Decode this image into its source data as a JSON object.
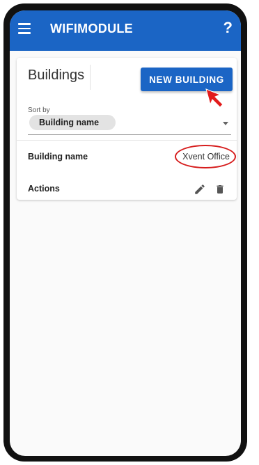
{
  "app": {
    "title": "WIFIMODULE",
    "help_label": "?",
    "accent_color": "#1b65c5"
  },
  "card": {
    "title": "Buildings",
    "new_building_label": "NEW BUILDING",
    "sort": {
      "label": "Sort by",
      "selected": "Building name"
    },
    "rows": [
      {
        "label": "Building name",
        "value": "Xvent Office"
      },
      {
        "label": "Actions"
      }
    ]
  },
  "icons": [
    "menu-icon",
    "help-icon",
    "pointer-arrow-icon",
    "chevron-down-icon",
    "edit-icon",
    "delete-icon"
  ],
  "annotation_color": "#d61c1c"
}
